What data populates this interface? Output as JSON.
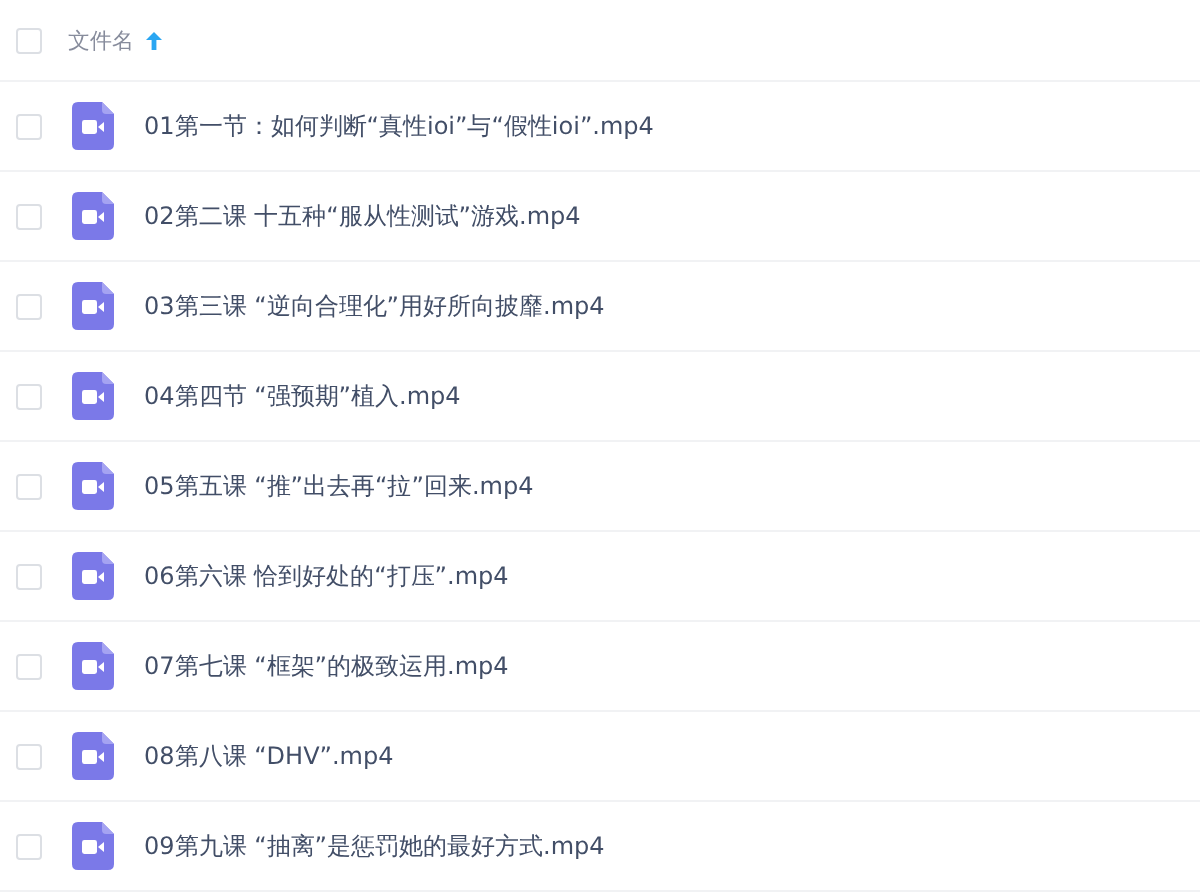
{
  "header": {
    "checked": false,
    "label": "文件名",
    "sorted_ascending": true
  },
  "files": [
    {
      "checked": false,
      "kind": "video",
      "name": "01第一节：如何判断“真性ioi”与“假性ioi”.mp4"
    },
    {
      "checked": false,
      "kind": "video",
      "name": "02第二课 十五种“服从性测试”游戏.mp4"
    },
    {
      "checked": false,
      "kind": "video",
      "name": "03第三课 “逆向合理化”用好所向披靡.mp4"
    },
    {
      "checked": false,
      "kind": "video",
      "name": "04第四节 “强预期”植入.mp4"
    },
    {
      "checked": false,
      "kind": "video",
      "name": "05第五课 “推”出去再“拉”回来.mp4"
    },
    {
      "checked": false,
      "kind": "video",
      "name": "06第六课 恰到好处的“打压”.mp4"
    },
    {
      "checked": false,
      "kind": "video",
      "name": "07第七课 “框架”的极致运用.mp4"
    },
    {
      "checked": false,
      "kind": "video",
      "name": "08第八课 “DHV”.mp4"
    },
    {
      "checked": false,
      "kind": "video",
      "name": "09第九课 “抽离”是惩罚她的最好方式.mp4"
    }
  ]
}
